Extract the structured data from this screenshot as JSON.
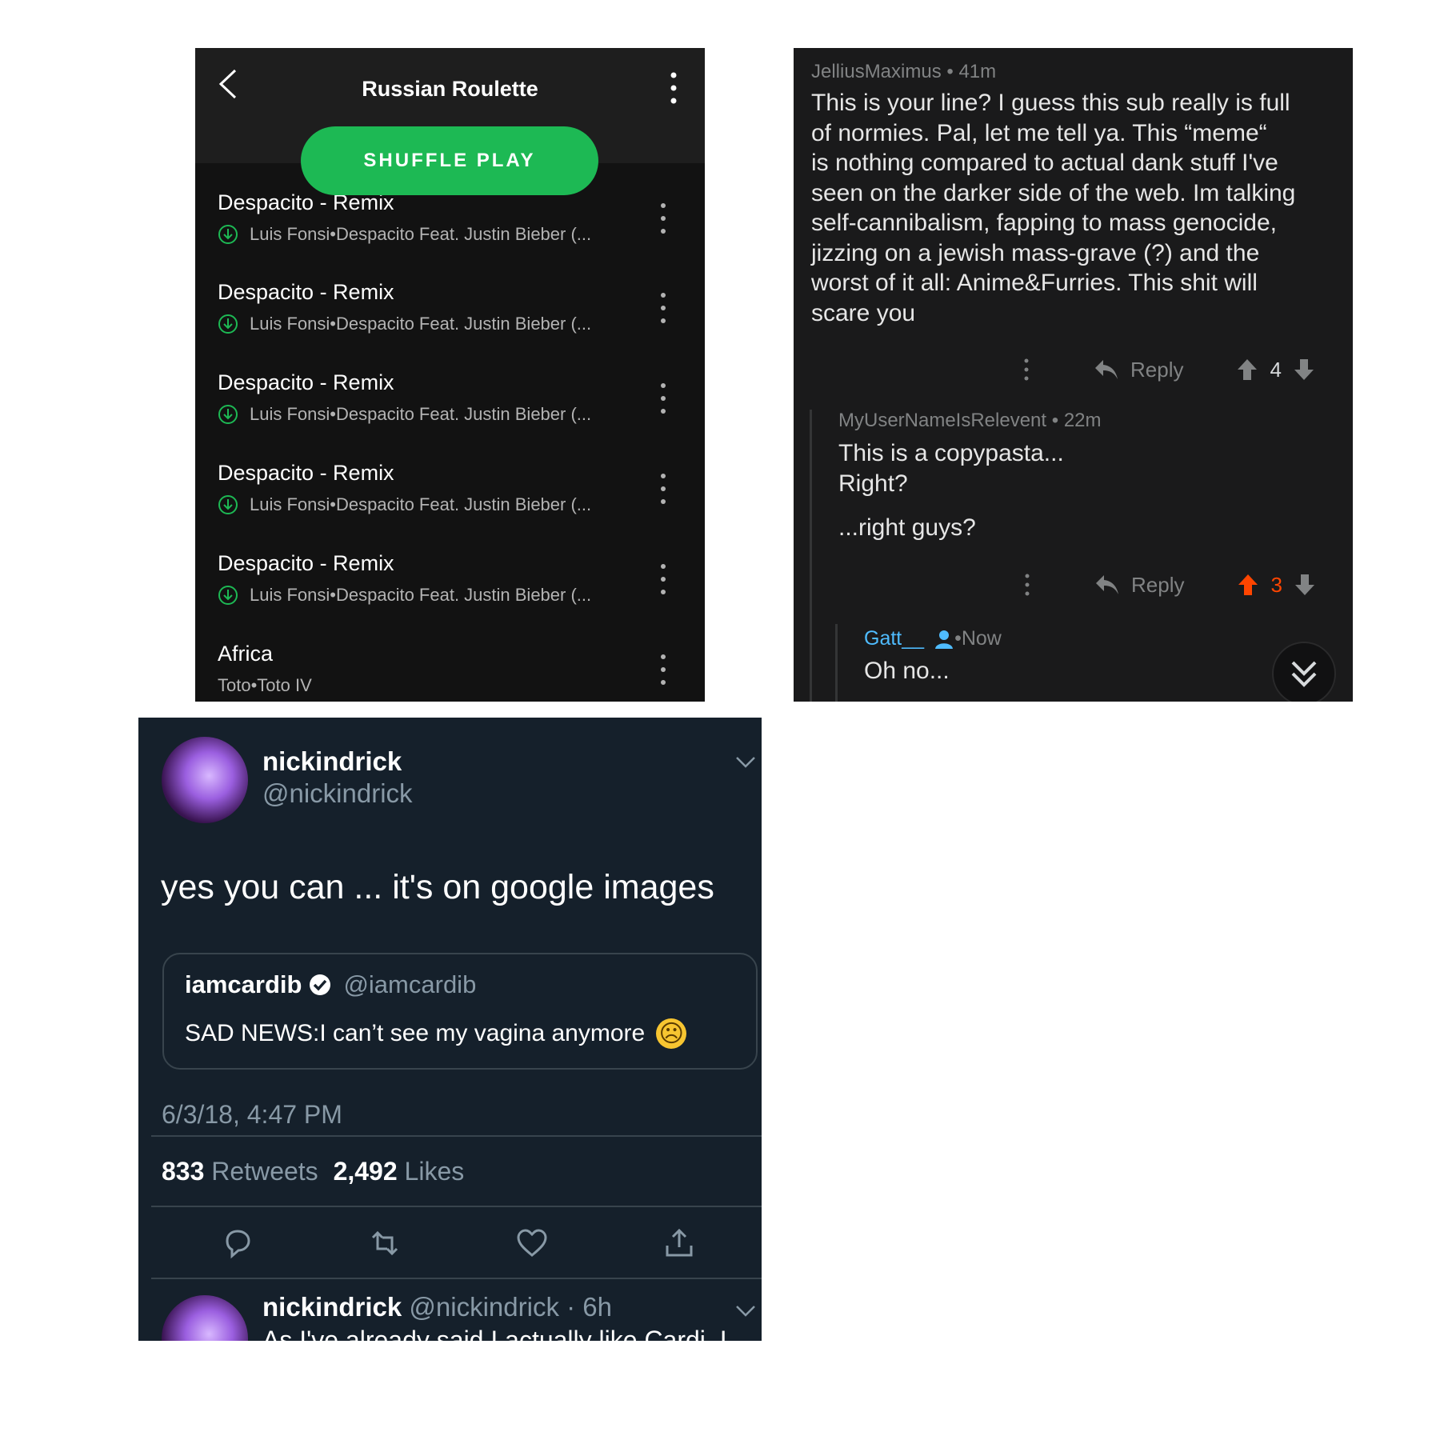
{
  "spotify": {
    "playlist_title": "Russian Roulette",
    "shuffle_label": "SHUFFLE PLAY",
    "accent": "#1db954",
    "tracks": [
      {
        "name": "Despacito - Remix",
        "artist": "Luis Fonsi",
        "album": "Despacito Feat. Justin Bieber (...",
        "downloaded": true
      },
      {
        "name": "Despacito - Remix",
        "artist": "Luis Fonsi",
        "album": "Despacito Feat. Justin Bieber (...",
        "downloaded": true
      },
      {
        "name": "Despacito - Remix",
        "artist": "Luis Fonsi",
        "album": "Despacito Feat. Justin Bieber (...",
        "downloaded": true
      },
      {
        "name": "Despacito - Remix",
        "artist": "Luis Fonsi",
        "album": "Despacito Feat. Justin Bieber (...",
        "downloaded": true
      },
      {
        "name": "Despacito - Remix",
        "artist": "Luis Fonsi",
        "album": "Despacito Feat. Justin Bieber (...",
        "downloaded": true
      },
      {
        "name": "Africa",
        "artist": "Toto",
        "album": "Toto IV",
        "downloaded": false
      }
    ],
    "separator": " • "
  },
  "reddit": {
    "comments": [
      {
        "author": "JelliusMaximus",
        "time": "41m",
        "lines": [
          "This is your line? I guess this sub really is full",
          "of normies. Pal, let me tell ya. This “meme“",
          "is nothing compared to actual dank stuff I've",
          "seen on the darker side of the web. Im talking",
          "self-cannibalism, fapping to mass genocide,",
          "jizzing on a jewish mass-grave (?) and the",
          "worst of it all: Anime&Furries. This shit will",
          "scare you"
        ],
        "reply_label": "Reply",
        "score": "4",
        "upvoted": false
      },
      {
        "author": "MyUserNameIsRelevent",
        "time": "22m",
        "lines": [
          "This is a copypasta...",
          "Right?",
          "...right guys?"
        ],
        "reply_label": "Reply",
        "score": "3",
        "upvoted": true
      },
      {
        "author": "Gatt__",
        "time": "Now",
        "lines": [
          "Oh no..."
        ]
      }
    ],
    "upvote_color": "#ff4500",
    "meta_separator": " • "
  },
  "twitter": {
    "tweet": {
      "name": "nickindrick",
      "handle": "@nickindrick",
      "text": "yes you can ... it's on google images",
      "quote": {
        "name": "iamcardib",
        "handle": "@iamcardib",
        "text": "SAD NEWS:I can’t see my vagina anymore",
        "emoji": "☹"
      },
      "timestamp": "6/3/18, 4:47 PM",
      "retweets_count": "833",
      "retweets_label": "Retweets",
      "likes_count": "2,492",
      "likes_label": "Likes"
    },
    "reply_tweet": {
      "name": "nickindrick",
      "handle": "@nickindrick",
      "age": "· 6h",
      "text_partial": "As I've already said I actually like Cardi, I"
    }
  }
}
